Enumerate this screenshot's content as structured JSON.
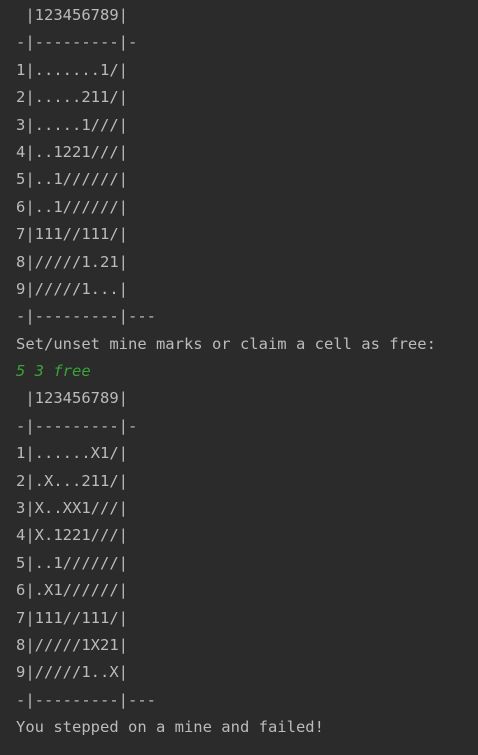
{
  "console": {
    "lines": [
      " |123456789|",
      "-|---------|-",
      "1|.......1/|",
      "2|.....211/|",
      "3|.....1///|",
      "4|..1221///|",
      "5|..1//////|",
      "6|..1//////|",
      "7|111//111/|",
      "8|/////1.21|",
      "9|/////1...|",
      "-|---------|---",
      "Set/unset mine marks or claim a cell as free:",
      "5 3 free",
      " |123456789|",
      "-|---------|-",
      "1|......X1/|",
      "2|.X...211/|",
      "3|X..XX1///|",
      "4|X.1221///|",
      "5|..1//////|",
      "6|.X1//////|",
      "7|111//111/|",
      "8|/////1X21|",
      "9|/////1..X|",
      "-|---------|---",
      "You stepped on a mine and failed!"
    ]
  },
  "colors": {
    "background": "#2b2b2b",
    "output_text": "#bbbbbb",
    "user_input": "#3aa33a"
  }
}
